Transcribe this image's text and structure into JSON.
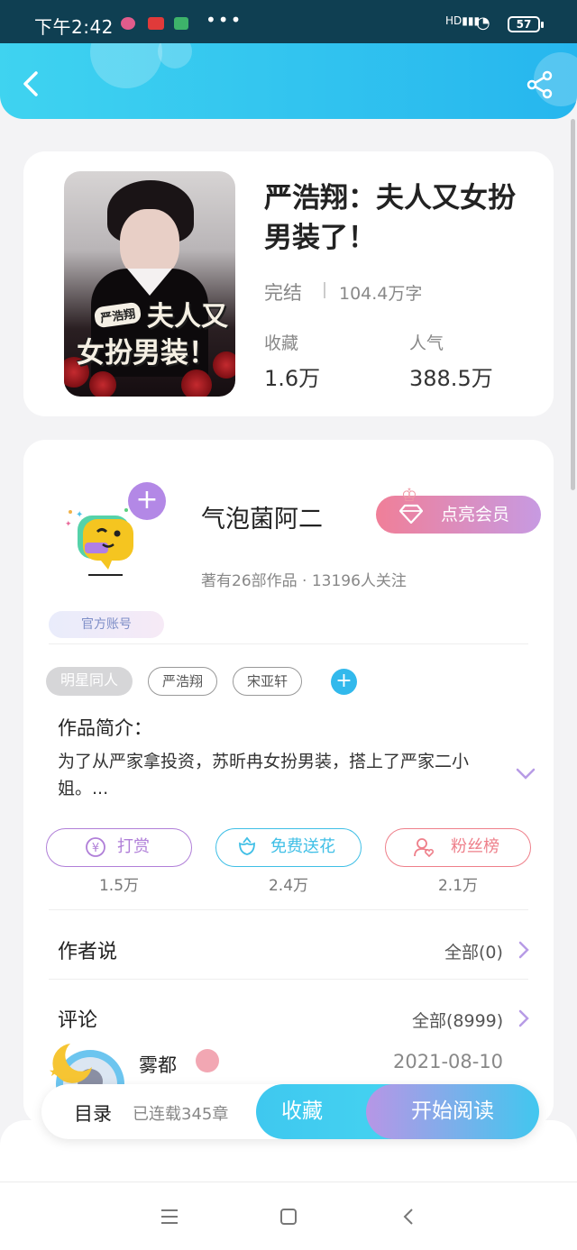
{
  "status_bar": {
    "time": "下午2:42",
    "battery": "57",
    "network": "HD",
    "more_dots": "•••"
  },
  "header": {
    "back_icon": "chevron-left-icon",
    "share_icon": "share-icon"
  },
  "book": {
    "title": "严浩翔：夫人又女扮男装了！",
    "status": "完结",
    "word_count": "104.4万字",
    "favorites_label": "收藏",
    "favorites_value": "1.6万",
    "popularity_label": "人气",
    "popularity_value": "388.5万",
    "cover": {
      "tag": "严浩翔",
      "title_line1": "夫人又",
      "title_line2": "女扮男装！"
    }
  },
  "author": {
    "name": "气泡菌阿二",
    "meta": "著有26部作品 · 13196人关注",
    "official_badge": "官方账号",
    "follow_symbol": "+",
    "vip_button": "点亮会员"
  },
  "tags": {
    "category": "明星同人",
    "items": [
      "严浩翔",
      "宋亚轩"
    ],
    "add_symbol": "+"
  },
  "intro": {
    "label": "作品简介：",
    "text": "为了从严家拿投资，苏昕冉女扮男装，搭上了严家二小姐。..."
  },
  "actions": [
    {
      "label": "打赏",
      "count": "1.5万",
      "color": "#b07fd8",
      "icon": "yen-coin-icon"
    },
    {
      "label": "免费送花",
      "count": "2.4万",
      "color": "#3fbfe6",
      "icon": "flower-icon"
    },
    {
      "label": "粉丝榜",
      "count": "2.1万",
      "color": "#ee7f8a",
      "icon": "fan-ranking-icon"
    }
  ],
  "author_says": {
    "title": "作者说",
    "more": "全部(0)"
  },
  "comments": {
    "title": "评论",
    "more": "全部(8999)",
    "first": {
      "user": "雾都",
      "date": "2021-08-10"
    }
  },
  "bottom_bar": {
    "toc": "目录",
    "serial": "已连载345章",
    "favorite": "收藏",
    "start_reading": "开始阅读"
  },
  "colors": {
    "accent": "#26b6ee",
    "purple": "#b388e6",
    "pink": "#f07f98"
  }
}
